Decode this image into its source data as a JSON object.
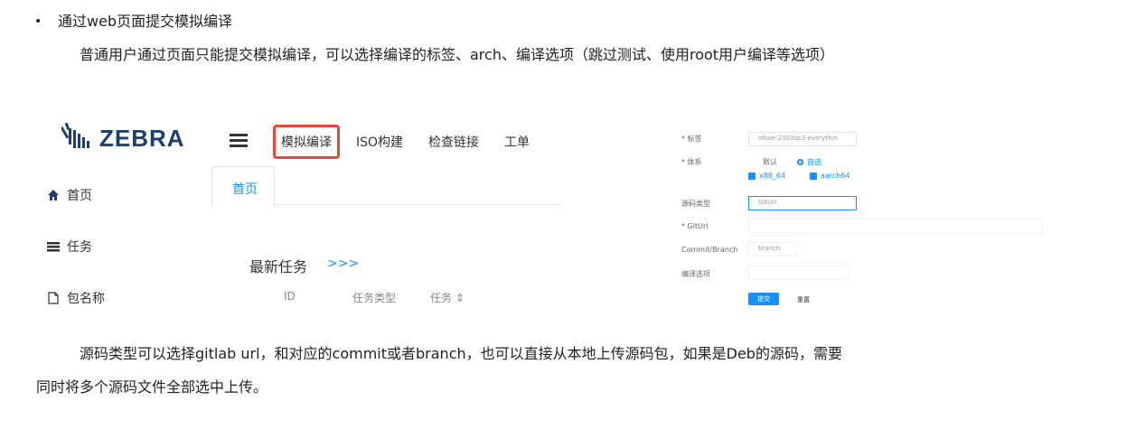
{
  "doc": {
    "bullet": "•",
    "heading": "通过web页面提交模拟编译",
    "intro": "普通用户通过页面只能提交模拟编译，可以选择编译的标签、arch、编译选项（跳过测试、使用root用户编译等选项）",
    "para1": "源码类型可以选择gitlab url，和对应的commit或者branch，也可以直接从本地上传源码包，如果是Deb的源码，需要",
    "para2": "同时将多个源码文件全部选中上传。"
  },
  "app": {
    "logo_text": "ZEBRA",
    "nav": [
      "模拟编译",
      "ISO构建",
      "检查链接",
      "工单"
    ],
    "sidebar": [
      {
        "label": "首页",
        "icon": "home-icon"
      },
      {
        "label": "任务",
        "icon": "tasks-icon"
      },
      {
        "label": "包名称",
        "icon": "file-icon"
      }
    ],
    "tab": "首页",
    "latest_title": "最新任务",
    "latest_link": ">>>",
    "columns": [
      "ID",
      "任务类型",
      "任务 ⇕"
    ]
  },
  "form": {
    "tag_label": "* 标签",
    "tag_value": "nfsoe-2003sp3-everythin",
    "arch_label": "* 体系",
    "arch_default": "默认",
    "arch_custom": "自选",
    "arch_opt1": "x86_64",
    "arch_opt2": "aarch64",
    "src_type_label": "源码类型",
    "src_type_value": "GitUrl",
    "giturl_label": "* GitUrl",
    "commit_label": "Commit/Branch",
    "commit_value": "branch",
    "opts_label": "编译选项",
    "submit": "提交",
    "reset": "重置"
  }
}
